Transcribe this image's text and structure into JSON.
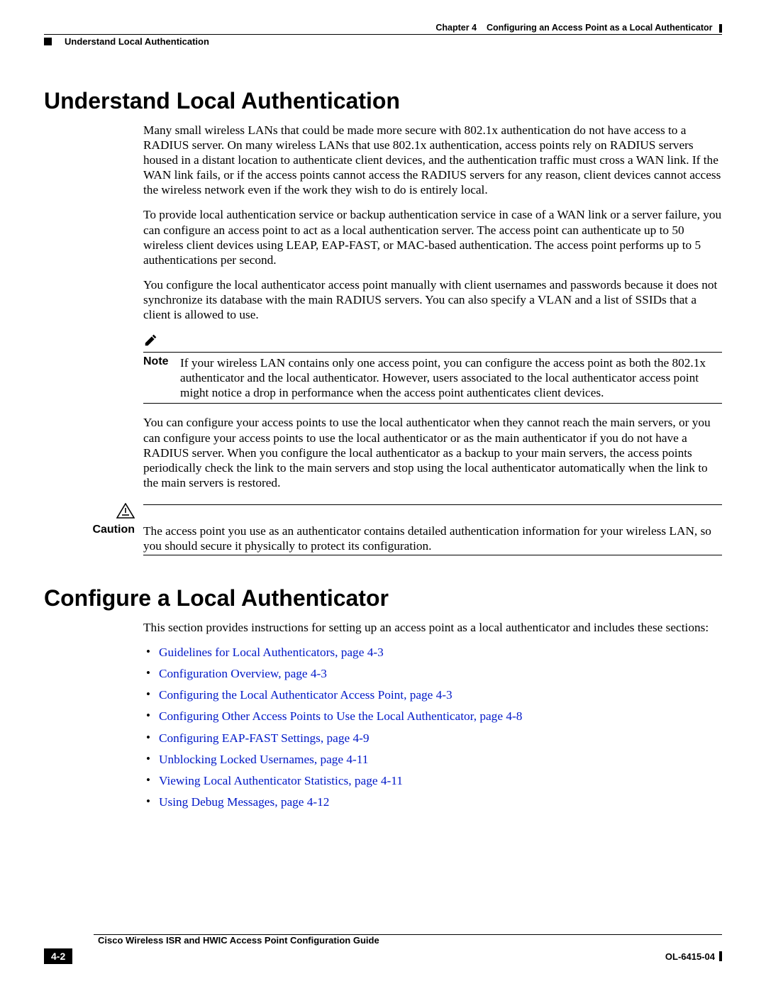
{
  "header": {
    "chapter_label": "Chapter 4",
    "chapter_title": "Configuring an Access Point as a Local Authenticator",
    "running_head": "Understand Local Authentication"
  },
  "sections": {
    "s1_title": "Understand Local Authentication",
    "p1": "Many small wireless LANs that could be made more secure with 802.1x authentication do not have access to a RADIUS server. On many wireless LANs that use 802.1x authentication, access points rely on RADIUS servers housed in a distant location to authenticate client devices, and the authentication traffic must cross a WAN link. If the WAN link fails, or if the access points cannot access the RADIUS servers for any reason, client devices cannot access the wireless network even if the work they wish to do is entirely local.",
    "p2": "To provide local authentication service or backup authentication service in case of a WAN link or a server failure, you can configure an access point to act as a local authentication server. The access point can authenticate up to 50 wireless client devices using LEAP, EAP-FAST, or MAC-based authentication. The access point performs up to 5 authentications per second.",
    "p3": "You configure the local authenticator access point manually with client usernames and passwords because it does not synchronize its database with the main RADIUS servers. You can also specify a VLAN and a list of SSIDs that a client is allowed to use.",
    "note_label": "Note",
    "note_text": "If your wireless LAN contains only one access point, you can configure the access point as both the 802.1x authenticator and the local authenticator. However, users associated to the local authenticator access point might notice a drop in performance when the access point authenticates client devices.",
    "p4": "You can configure your access points to use the local authenticator when they cannot reach the main servers, or you can configure your access points to use the local authenticator or as the main authenticator if you do not have a RADIUS server. When you configure the local authenticator as a backup to your main servers, the access points periodically check the link to the main servers and stop using the local authenticator automatically when the link to the main servers is restored.",
    "caution_label": "Caution",
    "caution_text": "The access point you use as an authenticator contains detailed authentication information for your wireless LAN, so you should secure it physically to protect its configuration.",
    "s2_title": "Configure a Local Authenticator",
    "p5": "This section provides instructions for setting up an access point as a local authenticator and includes these sections:",
    "links": [
      "Guidelines for Local Authenticators, page 4-3",
      "Configuration Overview, page 4-3",
      "Configuring the Local Authenticator Access Point, page 4-3",
      "Configuring Other Access Points to Use the Local Authenticator, page 4-8",
      "Configuring EAP-FAST Settings, page 4-9",
      "Unblocking Locked Usernames, page 4-11",
      "Viewing Local Authenticator Statistics, page 4-11",
      "Using Debug Messages, page 4-12"
    ]
  },
  "footer": {
    "guide_title": "Cisco Wireless ISR and HWIC Access Point Configuration Guide",
    "page_number": "4-2",
    "doc_id": "OL-6415-04"
  }
}
